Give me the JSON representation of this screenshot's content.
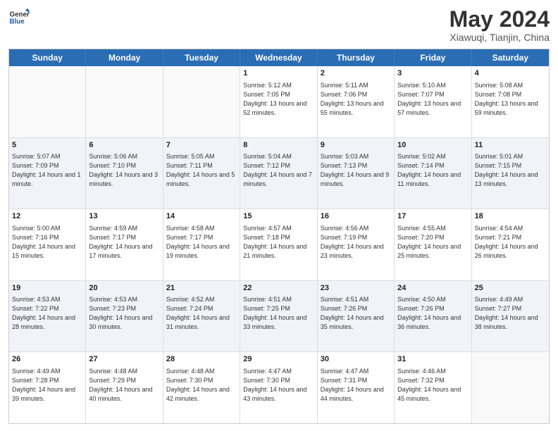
{
  "header": {
    "logo_line1": "General",
    "logo_line2": "Blue",
    "main_title": "May 2024",
    "sub_title": "Xiawuqi, Tianjin, China"
  },
  "days_of_week": [
    "Sunday",
    "Monday",
    "Tuesday",
    "Wednesday",
    "Thursday",
    "Friday",
    "Saturday"
  ],
  "weeks": [
    [
      {
        "day": "",
        "sunrise": "",
        "sunset": "",
        "daylight": ""
      },
      {
        "day": "",
        "sunrise": "",
        "sunset": "",
        "daylight": ""
      },
      {
        "day": "",
        "sunrise": "",
        "sunset": "",
        "daylight": ""
      },
      {
        "day": "1",
        "sunrise": "Sunrise: 5:12 AM",
        "sunset": "Sunset: 7:05 PM",
        "daylight": "Daylight: 13 hours and 52 minutes."
      },
      {
        "day": "2",
        "sunrise": "Sunrise: 5:11 AM",
        "sunset": "Sunset: 7:06 PM",
        "daylight": "Daylight: 13 hours and 55 minutes."
      },
      {
        "day": "3",
        "sunrise": "Sunrise: 5:10 AM",
        "sunset": "Sunset: 7:07 PM",
        "daylight": "Daylight: 13 hours and 57 minutes."
      },
      {
        "day": "4",
        "sunrise": "Sunrise: 5:08 AM",
        "sunset": "Sunset: 7:08 PM",
        "daylight": "Daylight: 13 hours and 59 minutes."
      }
    ],
    [
      {
        "day": "5",
        "sunrise": "Sunrise: 5:07 AM",
        "sunset": "Sunset: 7:09 PM",
        "daylight": "Daylight: 14 hours and 1 minute."
      },
      {
        "day": "6",
        "sunrise": "Sunrise: 5:06 AM",
        "sunset": "Sunset: 7:10 PM",
        "daylight": "Daylight: 14 hours and 3 minutes."
      },
      {
        "day": "7",
        "sunrise": "Sunrise: 5:05 AM",
        "sunset": "Sunset: 7:11 PM",
        "daylight": "Daylight: 14 hours and 5 minutes."
      },
      {
        "day": "8",
        "sunrise": "Sunrise: 5:04 AM",
        "sunset": "Sunset: 7:12 PM",
        "daylight": "Daylight: 14 hours and 7 minutes."
      },
      {
        "day": "9",
        "sunrise": "Sunrise: 5:03 AM",
        "sunset": "Sunset: 7:13 PM",
        "daylight": "Daylight: 14 hours and 9 minutes."
      },
      {
        "day": "10",
        "sunrise": "Sunrise: 5:02 AM",
        "sunset": "Sunset: 7:14 PM",
        "daylight": "Daylight: 14 hours and 11 minutes."
      },
      {
        "day": "11",
        "sunrise": "Sunrise: 5:01 AM",
        "sunset": "Sunset: 7:15 PM",
        "daylight": "Daylight: 14 hours and 13 minutes."
      }
    ],
    [
      {
        "day": "12",
        "sunrise": "Sunrise: 5:00 AM",
        "sunset": "Sunset: 7:16 PM",
        "daylight": "Daylight: 14 hours and 15 minutes."
      },
      {
        "day": "13",
        "sunrise": "Sunrise: 4:59 AM",
        "sunset": "Sunset: 7:17 PM",
        "daylight": "Daylight: 14 hours and 17 minutes."
      },
      {
        "day": "14",
        "sunrise": "Sunrise: 4:58 AM",
        "sunset": "Sunset: 7:17 PM",
        "daylight": "Daylight: 14 hours and 19 minutes."
      },
      {
        "day": "15",
        "sunrise": "Sunrise: 4:57 AM",
        "sunset": "Sunset: 7:18 PM",
        "daylight": "Daylight: 14 hours and 21 minutes."
      },
      {
        "day": "16",
        "sunrise": "Sunrise: 4:56 AM",
        "sunset": "Sunset: 7:19 PM",
        "daylight": "Daylight: 14 hours and 23 minutes."
      },
      {
        "day": "17",
        "sunrise": "Sunrise: 4:55 AM",
        "sunset": "Sunset: 7:20 PM",
        "daylight": "Daylight: 14 hours and 25 minutes."
      },
      {
        "day": "18",
        "sunrise": "Sunrise: 4:54 AM",
        "sunset": "Sunset: 7:21 PM",
        "daylight": "Daylight: 14 hours and 26 minutes."
      }
    ],
    [
      {
        "day": "19",
        "sunrise": "Sunrise: 4:53 AM",
        "sunset": "Sunset: 7:22 PM",
        "daylight": "Daylight: 14 hours and 28 minutes."
      },
      {
        "day": "20",
        "sunrise": "Sunrise: 4:53 AM",
        "sunset": "Sunset: 7:23 PM",
        "daylight": "Daylight: 14 hours and 30 minutes."
      },
      {
        "day": "21",
        "sunrise": "Sunrise: 4:52 AM",
        "sunset": "Sunset: 7:24 PM",
        "daylight": "Daylight: 14 hours and 31 minutes."
      },
      {
        "day": "22",
        "sunrise": "Sunrise: 4:51 AM",
        "sunset": "Sunset: 7:25 PM",
        "daylight": "Daylight: 14 hours and 33 minutes."
      },
      {
        "day": "23",
        "sunrise": "Sunrise: 4:51 AM",
        "sunset": "Sunset: 7:26 PM",
        "daylight": "Daylight: 14 hours and 35 minutes."
      },
      {
        "day": "24",
        "sunrise": "Sunrise: 4:50 AM",
        "sunset": "Sunset: 7:26 PM",
        "daylight": "Daylight: 14 hours and 36 minutes."
      },
      {
        "day": "25",
        "sunrise": "Sunrise: 4:49 AM",
        "sunset": "Sunset: 7:27 PM",
        "daylight": "Daylight: 14 hours and 38 minutes."
      }
    ],
    [
      {
        "day": "26",
        "sunrise": "Sunrise: 4:49 AM",
        "sunset": "Sunset: 7:28 PM",
        "daylight": "Daylight: 14 hours and 39 minutes."
      },
      {
        "day": "27",
        "sunrise": "Sunrise: 4:48 AM",
        "sunset": "Sunset: 7:29 PM",
        "daylight": "Daylight: 14 hours and 40 minutes."
      },
      {
        "day": "28",
        "sunrise": "Sunrise: 4:48 AM",
        "sunset": "Sunset: 7:30 PM",
        "daylight": "Daylight: 14 hours and 42 minutes."
      },
      {
        "day": "29",
        "sunrise": "Sunrise: 4:47 AM",
        "sunset": "Sunset: 7:30 PM",
        "daylight": "Daylight: 14 hours and 43 minutes."
      },
      {
        "day": "30",
        "sunrise": "Sunrise: 4:47 AM",
        "sunset": "Sunset: 7:31 PM",
        "daylight": "Daylight: 14 hours and 44 minutes."
      },
      {
        "day": "31",
        "sunrise": "Sunrise: 4:46 AM",
        "sunset": "Sunset: 7:32 PM",
        "daylight": "Daylight: 14 hours and 45 minutes."
      },
      {
        "day": "",
        "sunrise": "",
        "sunset": "",
        "daylight": ""
      }
    ]
  ]
}
